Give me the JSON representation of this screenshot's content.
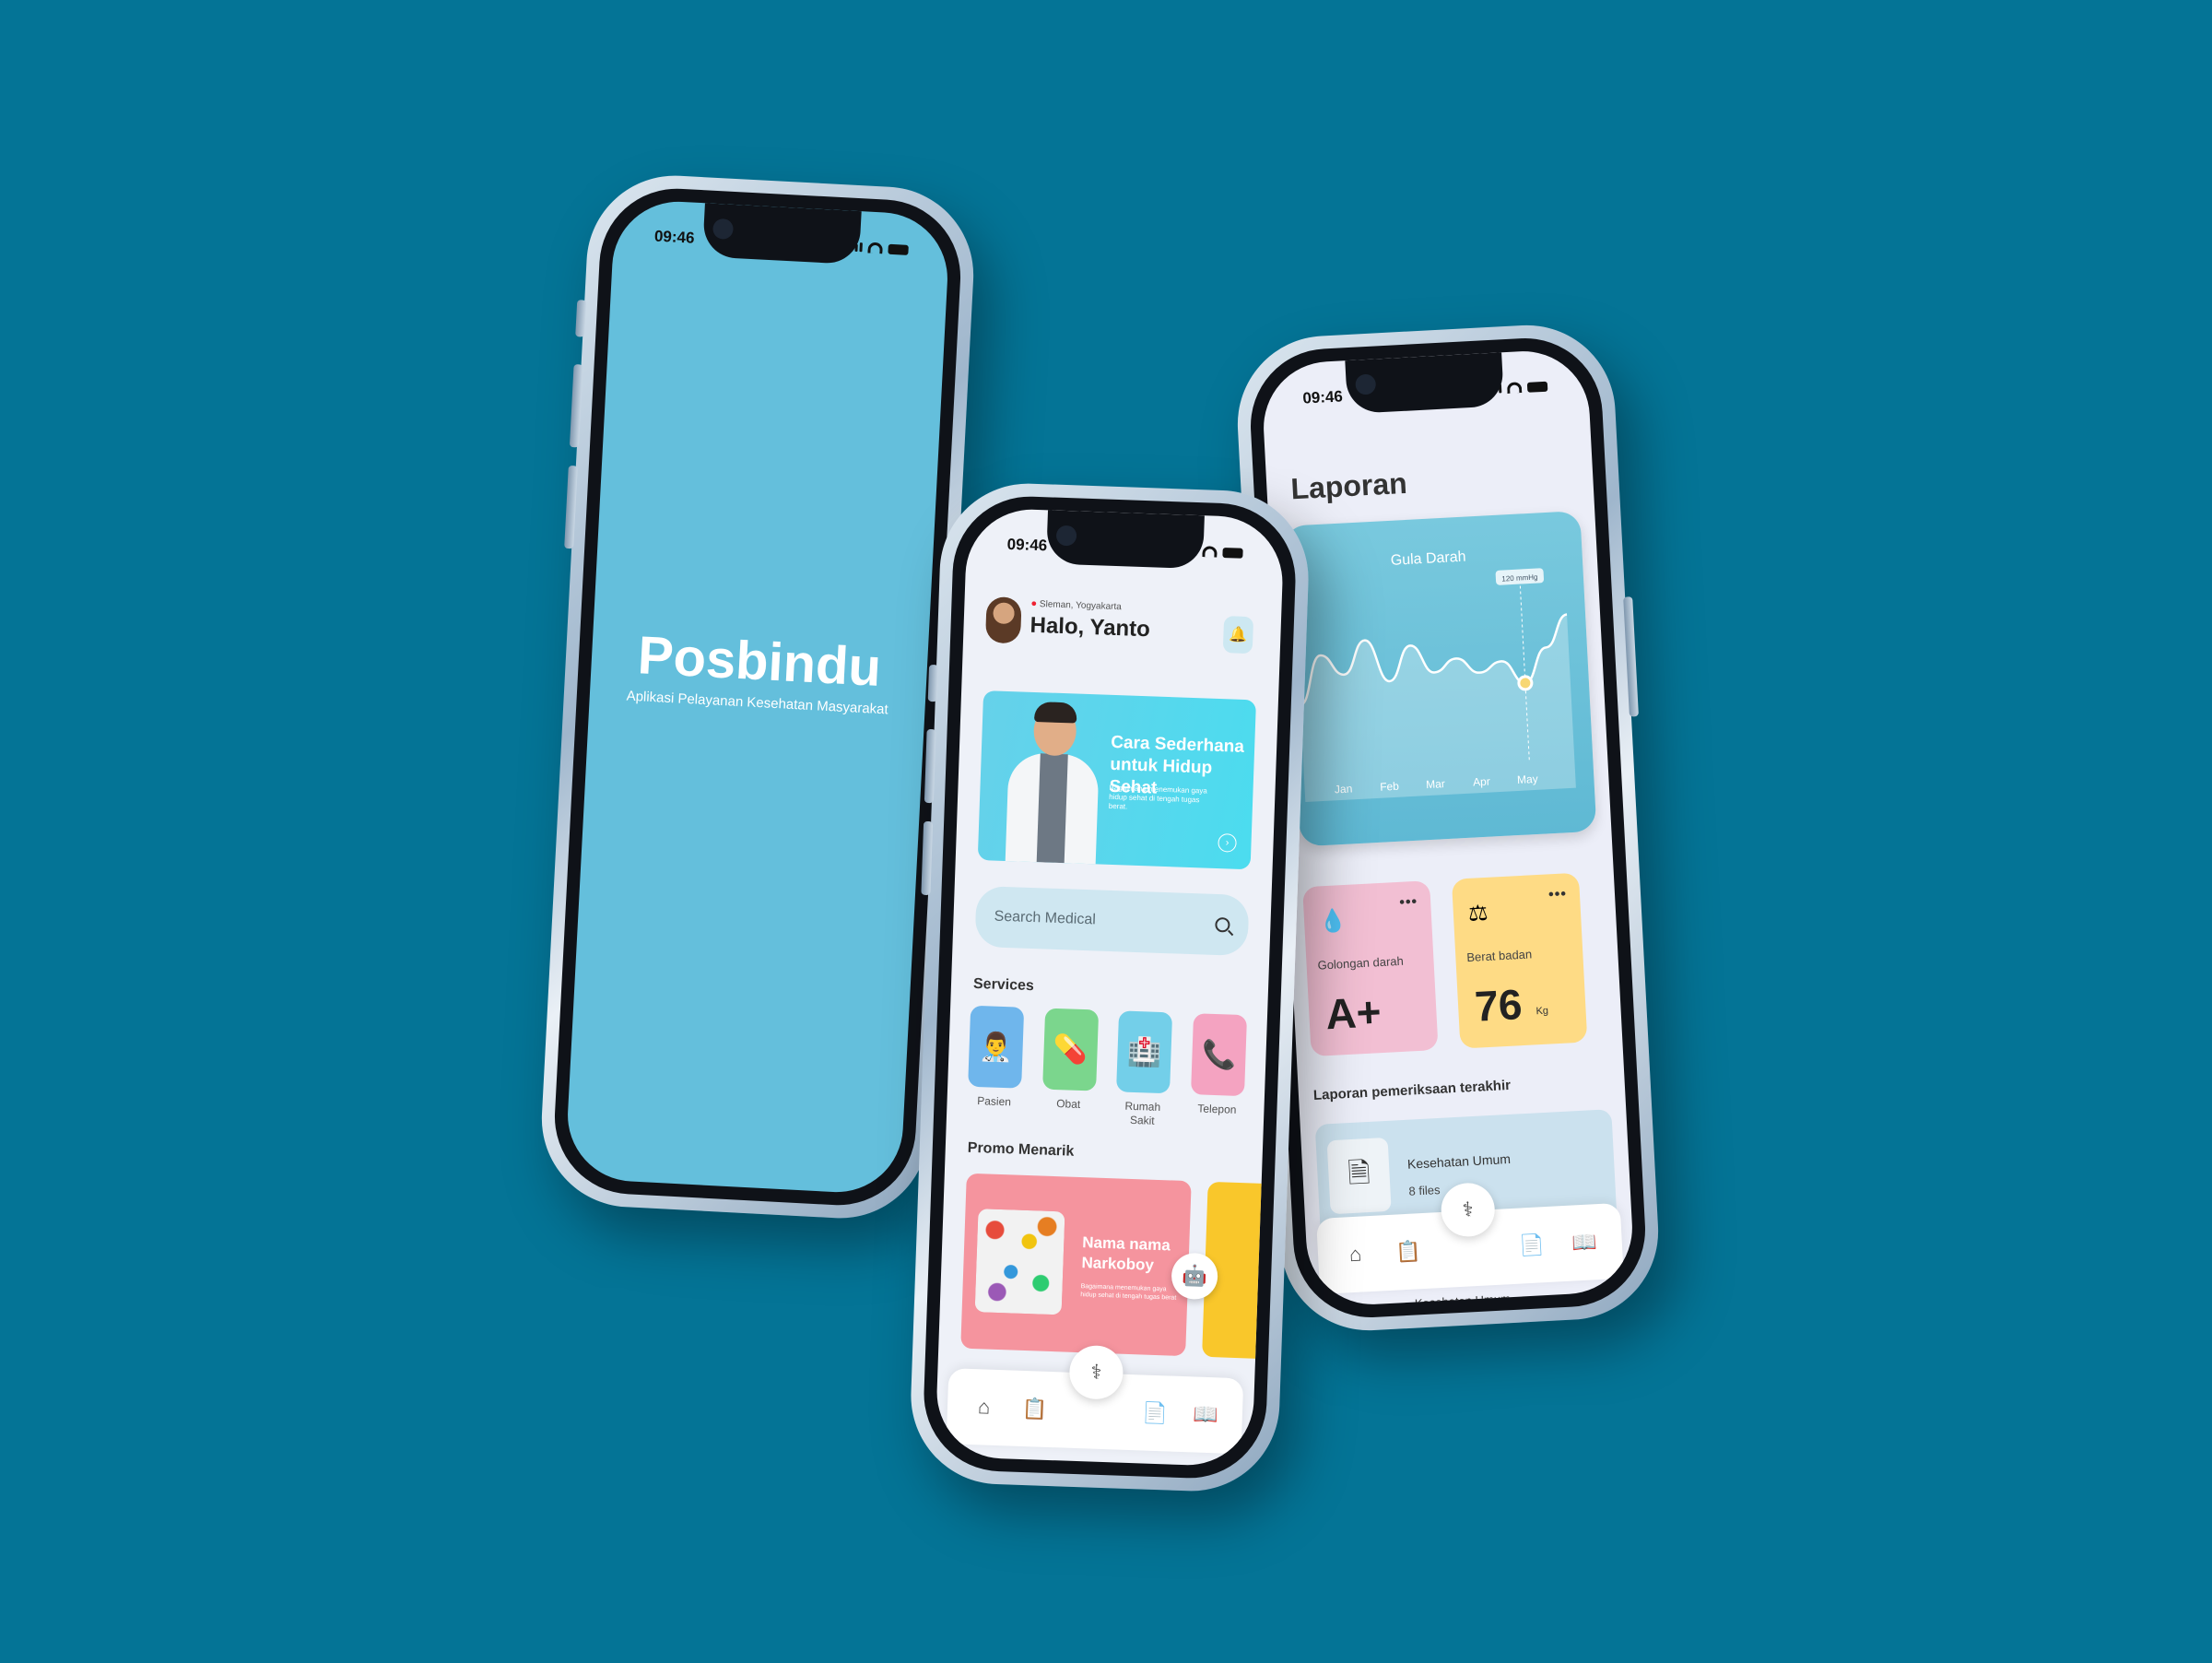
{
  "status_time": "09:46",
  "splash": {
    "title": "Posbindu",
    "subtitle": "Aplikasi Pelayanan Kesehatan Masyarakat"
  },
  "home": {
    "location": "Sleman, Yogyakarta",
    "greeting": "Halo, Yanto",
    "banner": {
      "title": "Cara Sederhana untuk Hidup Sehat",
      "text": "Bagaimana menemukan gaya hidup sehat di tengah tugas berat."
    },
    "search_placeholder": "Search Medical",
    "services_title": "Services",
    "services": [
      {
        "label": "Pasien",
        "icon": "doctor-icon",
        "color": "#6fb6ec",
        "glyph": "👨‍⚕"
      },
      {
        "label": "Obat",
        "icon": "pill-icon",
        "color": "#7bd68d",
        "glyph": "💊"
      },
      {
        "label": "Rumah Sakit",
        "icon": "hospital-icon",
        "color": "#73cfe9",
        "glyph": "🏥"
      },
      {
        "label": "Telepon",
        "icon": "phone-icon",
        "color": "#f4a3c1",
        "glyph": "📞"
      }
    ],
    "promo_title": "Promo Menarik",
    "promo": {
      "title": "Nama nama Narkoboy",
      "text": "Bagaimana menemukan gaya hidup sehat di tengah tugas berat"
    }
  },
  "report": {
    "title": "Laporan",
    "chart_data": {
      "type": "area",
      "title": "Gula Darah",
      "x": [
        "Jan",
        "Feb",
        "Mar",
        "Apr",
        "May"
      ],
      "tooltip": "120 mmHg",
      "values": [
        40,
        78,
        62,
        88,
        55,
        82,
        60,
        70,
        58,
        66,
        48,
        75,
        100
      ],
      "ylim": [
        0,
        130
      ]
    },
    "stats": [
      {
        "label": "Golongan darah",
        "value": "A+",
        "unit": "",
        "icon": "blood-drop-icon"
      },
      {
        "label": "Berat badan",
        "value": "76",
        "unit": "Kg",
        "icon": "scale-icon"
      }
    ],
    "recent_title": "Laporan pemeriksaan terakhir",
    "items": [
      {
        "title": "Kesehatan Umum",
        "subtitle": "8 files"
      },
      {
        "title": "Kesehatan Umum",
        "subtitle": ""
      }
    ]
  },
  "tabbar": {
    "home": "⌂",
    "clipboard": "📋",
    "center": "⚕",
    "document": "📄",
    "book": "📖"
  }
}
